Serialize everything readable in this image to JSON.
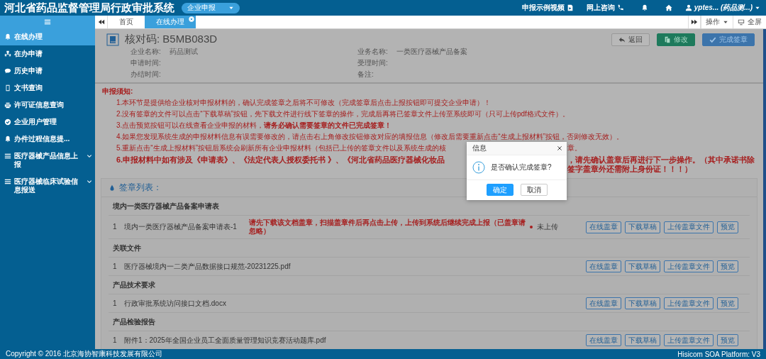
{
  "header": {
    "title": "河北省药品监督管理局行政审批系统",
    "mode_dropdown": "企业申报",
    "links": [
      "申报示例视频",
      "网上咨询"
    ],
    "user": "yptes...",
    "user_org": "(药品测...)"
  },
  "sidebar": {
    "items": [
      {
        "label": "在线办理",
        "selected": true,
        "expandable": false
      },
      {
        "label": "在办申请",
        "selected": false,
        "expandable": false
      },
      {
        "label": "历史申请",
        "selected": false,
        "expandable": false
      },
      {
        "label": "文书查询",
        "selected": false,
        "expandable": false
      },
      {
        "label": "许可证信息查询",
        "selected": false,
        "expandable": false
      },
      {
        "label": "企业用户管理",
        "selected": false,
        "expandable": false
      },
      {
        "label": "办件过程信息提...",
        "selected": false,
        "expandable": false
      },
      {
        "label": "医疗器械产品信息上报",
        "selected": false,
        "expandable": true
      },
      {
        "label": "医疗器械临床试验信息报送",
        "selected": false,
        "expandable": true
      }
    ]
  },
  "tabs": [
    {
      "label": "首页",
      "selected": false,
      "closable": false
    },
    {
      "label": "在线办理",
      "selected": true,
      "closable": true
    }
  ],
  "toolbar": {
    "operations": "操作",
    "fullscreen": "全屏"
  },
  "record": {
    "code_label": "核对码:",
    "code": "B5MB083D",
    "fields": [
      {
        "label": "企业名称:",
        "value": "药品测试"
      },
      {
        "label": "业务名称:",
        "value": "一类医疗器械产品备案"
      },
      {
        "label": "申请时间:"
      },
      {
        "label": "受理时间:"
      },
      {
        "label": "办结时间:"
      },
      {
        "label": "备注:"
      }
    ],
    "buttons": [
      {
        "label": "返回",
        "kind": "back"
      },
      {
        "label": "修改",
        "kind": "edit"
      },
      {
        "label": "完成签章",
        "kind": "finish"
      }
    ]
  },
  "notice": {
    "title": "申报须知:",
    "lines": [
      {
        "kind": "plain",
        "text": "1.本环节是提供给企业核对申报材料的，确认完成签章之后将不可修改（完成签章后点击上报按钮即可提交企业申请）！"
      },
      {
        "kind": "plain",
        "text": "2.没有签章的文件可以点击“下载草稿”按钮，先下载文件进行线下签章的操作，完成后再将已签章文件上传至系统即可（只可上传pdf格式文件）。"
      },
      {
        "kind": "plain",
        "text": "3.点击预览按钮可以在线查看企业申报的材料，**请务必确认需要签章的文件已完成签章！**"
      },
      {
        "kind": "plain",
        "text": "4.如果您发现系统生成的申报材料信息有误需要修改的，请点击右上角修改按钮修改对应的填报信息（修改后需要重新点击“生成上报材料”按钮，否则修改无效）。"
      },
      {
        "kind": "plain",
        "text": "5.重新点击“生成上报材料”按钮后系统会刷新所有企业申报材料（包括已上传的签章文件以及系统生成的核",
        "text_after": "章。"
      },
      {
        "kind": "emphasis",
        "text": "6.申报材料中如有涉及《申请表》、《法定代表人授权委托书 》、《河北省药品医疗器械化妆品",
        "text_after": "，请先确认盖章后再进行下一步操作。（其中承诺书除签字盖章外还需附上身份证！！！）"
      }
    ]
  },
  "sign_list": {
    "title": "签章列表：",
    "groups": [
      {
        "title": "境内一类医疗器械产品备案申请表",
        "files": [
          {
            "index": "1",
            "name": "境内一类医疗器械产品备案申请表-1",
            "warning": "请先下载该文档盖章，扫描盖章件后再点击上传，上传到系统后继续完成上报（已盖章请忽略）",
            "status": "未上传",
            "actions": [
              "在线盖章",
              "下载草稿",
              "上传盖章文件",
              "预览"
            ]
          }
        ]
      },
      {
        "title": "关联文件",
        "files": [
          {
            "index": "1",
            "name": "医疗器械境内一二类产品数据接口规范-20231225.pdf",
            "actions": [
              "在线盖章",
              "下载草稿",
              "上传盖章文件",
              "预览"
            ]
          }
        ]
      },
      {
        "title": "产品技术要求",
        "files": [
          {
            "index": "1",
            "name": "行政审批系统访问接口文档.docx",
            "actions": [
              "在线盖章",
              "下载草稿",
              "上传盖章文件",
              "预览"
            ]
          }
        ]
      },
      {
        "title": "产品检验报告",
        "files": [
          {
            "index": "1",
            "name": "附件1：2025年全国企业员工全面质量管理知识竞赛活动题库.pdf",
            "actions": [
              "在线盖章",
              "下载草稿",
              "上传盖章文件",
              "预览"
            ]
          }
        ]
      }
    ]
  },
  "modal": {
    "title": "信息",
    "message": "是否确认完成签章?",
    "confirm": "确定",
    "cancel": "取消"
  },
  "footer": {
    "copyright": "Copyright © 2016 北京海协智康科技发展有限公司",
    "platform": "Hisicom SOA Platform:  V3"
  }
}
